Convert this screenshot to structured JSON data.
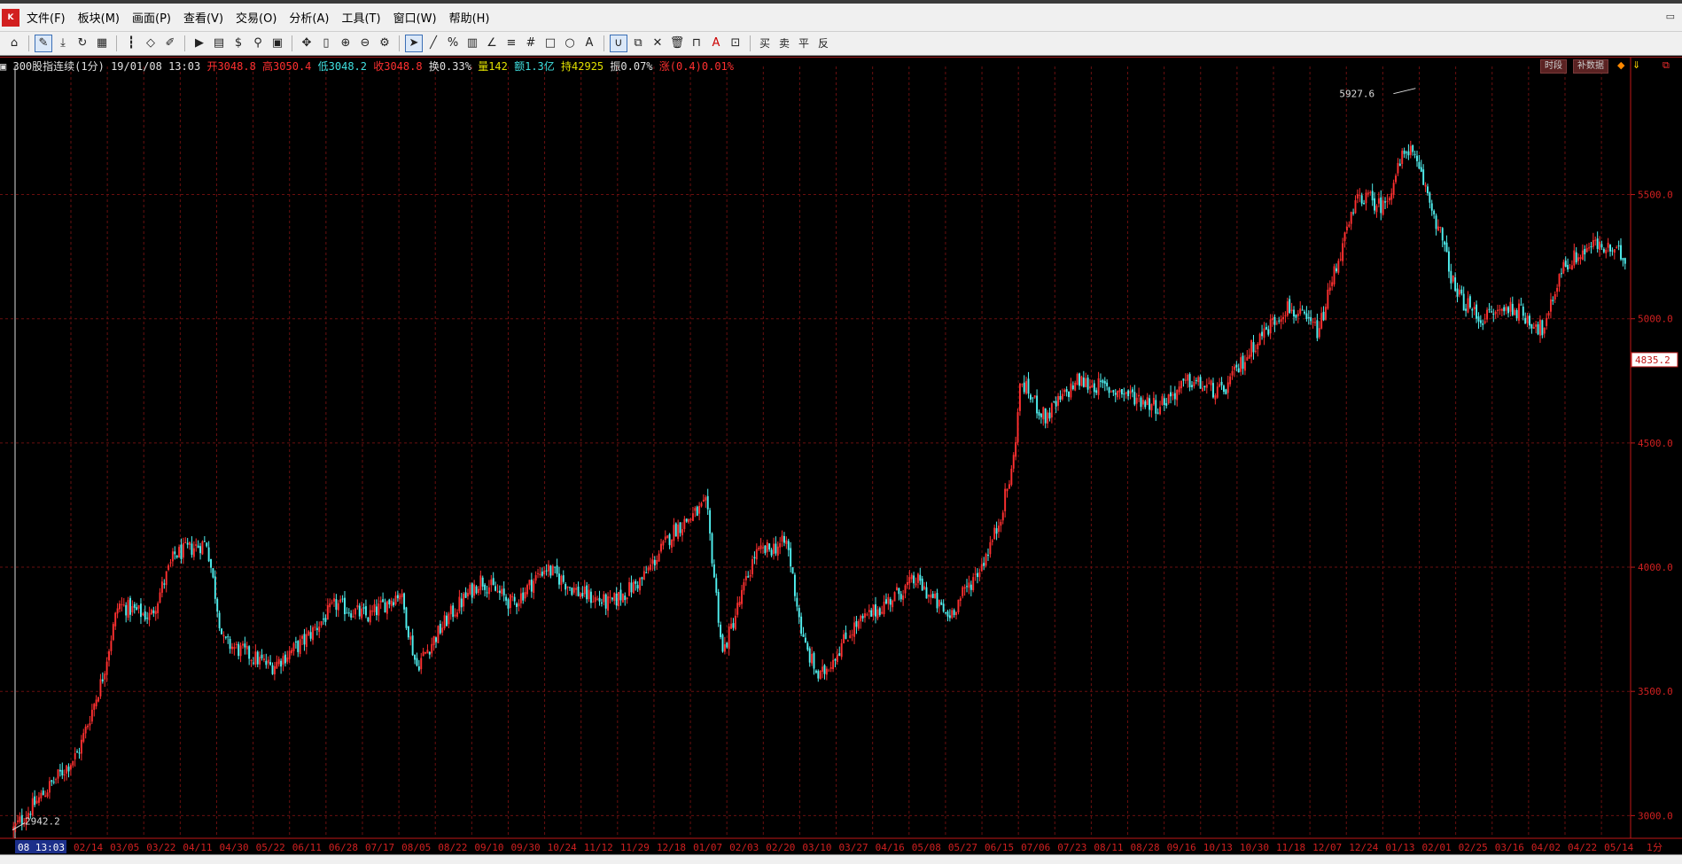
{
  "menu": {
    "logo_label": "K",
    "items": [
      "文件(F)",
      "板块(M)",
      "画面(P)",
      "查看(V)",
      "交易(O)",
      "分析(A)",
      "工具(T)",
      "窗口(W)",
      "帮助(H)"
    ]
  },
  "toolbar": {
    "buy_label": "买",
    "sell_label": "卖",
    "flat_label": "平",
    "reverse_label": "反"
  },
  "info": {
    "name": "300股指连续(1分)",
    "datetime": "19/01/08 13:03",
    "open": "开3048.8",
    "high": "高3050.4",
    "low": "低3048.2",
    "close": "收3048.8",
    "turnover_rate": "换0.33%",
    "volume": "量142",
    "amount": "额1.3亿",
    "open_interest": "持42925",
    "amplitude": "振0.07%",
    "change": "涨(0.4)0.01%",
    "colors": {
      "open": "#ff3030",
      "high": "#ff3030",
      "low": "#40e0e0",
      "close": "#ff3030",
      "turnover": "#e0e0e0",
      "volume": "#e0e000",
      "amount": "#40e0e0",
      "oi": "#e0e000",
      "amp": "#e0e0e0",
      "change": "#ff3030"
    }
  },
  "buttons": {
    "time_share": "时段",
    "fill_data": "补数据"
  },
  "price_labels": {
    "max": "5927.6",
    "min": "2942.2",
    "current": "4835.2"
  },
  "status": {
    "cursor_date": "08 13:03",
    "period": "1分"
  },
  "colors": {
    "up": "#ff3030",
    "down": "#50f0f0",
    "grid": "#6a0f0f",
    "axis_text": "#d02020",
    "background": "#000000"
  },
  "chart_data": {
    "type": "candlestick",
    "y_ticks": [
      3000,
      3500,
      4000,
      4500,
      5000,
      5500
    ],
    "y_tick_labels": [
      "3000.0",
      "3500.0",
      "4000.0",
      "4500.0",
      "5000.0",
      "5500.0"
    ],
    "ylim": [
      2930,
      5980
    ],
    "x_tick_labels": [
      "02/14",
      "03/05",
      "03/22",
      "04/11",
      "04/30",
      "05/22",
      "06/11",
      "06/28",
      "07/17",
      "08/05",
      "08/22",
      "09/10",
      "09/30",
      "10/24",
      "11/12",
      "11/29",
      "12/18",
      "01/07",
      "02/03",
      "02/20",
      "03/10",
      "03/27",
      "04/16",
      "05/08",
      "05/27",
      "06/15",
      "07/06",
      "07/23",
      "08/11",
      "08/28",
      "09/16",
      "10/13",
      "10/30",
      "11/18",
      "12/07",
      "12/24",
      "01/13",
      "02/01",
      "02/25",
      "03/16",
      "04/02",
      "04/22",
      "05/14"
    ],
    "price_path": [
      [
        0,
        2945
      ],
      [
        0.02,
        3100
      ],
      [
        0.04,
        3250
      ],
      [
        0.055,
        3550
      ],
      [
        0.065,
        3850
      ],
      [
        0.085,
        3800
      ],
      [
        0.1,
        4050
      ],
      [
        0.12,
        4100
      ],
      [
        0.13,
        3700
      ],
      [
        0.16,
        3600
      ],
      [
        0.18,
        3700
      ],
      [
        0.2,
        3850
      ],
      [
        0.22,
        3800
      ],
      [
        0.24,
        3900
      ],
      [
        0.25,
        3600
      ],
      [
        0.27,
        3800
      ],
      [
        0.29,
        3950
      ],
      [
        0.31,
        3850
      ],
      [
        0.33,
        4000
      ],
      [
        0.35,
        3900
      ],
      [
        0.37,
        3850
      ],
      [
        0.39,
        3950
      ],
      [
        0.41,
        4150
      ],
      [
        0.43,
        4250
      ],
      [
        0.44,
        3650
      ],
      [
        0.46,
        4050
      ],
      [
        0.48,
        4100
      ],
      [
        0.49,
        3700
      ],
      [
        0.5,
        3550
      ],
      [
        0.52,
        3750
      ],
      [
        0.54,
        3850
      ],
      [
        0.56,
        3950
      ],
      [
        0.58,
        3800
      ],
      [
        0.6,
        4000
      ],
      [
        0.61,
        4150
      ],
      [
        0.62,
        4400
      ],
      [
        0.625,
        4750
      ],
      [
        0.64,
        4600
      ],
      [
        0.66,
        4750
      ],
      [
        0.69,
        4700
      ],
      [
        0.71,
        4650
      ],
      [
        0.73,
        4750
      ],
      [
        0.75,
        4700
      ],
      [
        0.77,
        4900
      ],
      [
        0.79,
        5050
      ],
      [
        0.81,
        4950
      ],
      [
        0.82,
        5200
      ],
      [
        0.835,
        5500
      ],
      [
        0.85,
        5450
      ],
      [
        0.865,
        5700
      ],
      [
        0.875,
        5550
      ],
      [
        0.885,
        5350
      ],
      [
        0.895,
        5100
      ],
      [
        0.91,
        5000
      ],
      [
        0.93,
        5050
      ],
      [
        0.95,
        4950
      ],
      [
        0.96,
        5200
      ],
      [
        0.98,
        5300
      ],
      [
        1.0,
        5250
      ]
    ]
  }
}
